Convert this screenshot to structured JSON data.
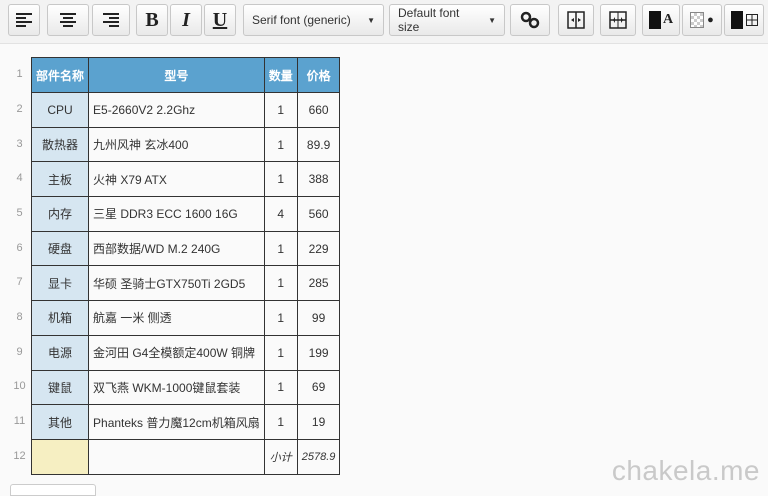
{
  "toolbar": {
    "bold_label": "B",
    "italic_label": "I",
    "underline_label": "U",
    "font_family": "Serif font (generic)",
    "font_size": "Default font size",
    "text_color_letter": "A"
  },
  "sheet": {
    "row_numbers": [
      "1",
      "2",
      "3",
      "4",
      "5",
      "6",
      "7",
      "8",
      "9",
      "10",
      "11",
      "12"
    ],
    "header": [
      "部件名称",
      "型号",
      "数量",
      "价格"
    ],
    "rows": [
      [
        "CPU",
        "E5-2660V2 2.2Ghz",
        "1",
        "660"
      ],
      [
        "散热器",
        "九州风神 玄冰400",
        "1",
        "89.9"
      ],
      [
        "主板",
        "火神 X79 ATX",
        "1",
        "388"
      ],
      [
        "内存",
        "三星 DDR3 ECC 1600 16G",
        "4",
        "560"
      ],
      [
        "硬盘",
        "西部数据/WD M.2 240G",
        "1",
        "229"
      ],
      [
        "显卡",
        "华硕 圣骑士GTX750Ti 2GD5",
        "1",
        "285"
      ],
      [
        "机箱",
        "航嘉 一米 侧透",
        "1",
        "99"
      ],
      [
        "电源",
        "金河田 G4全模额定400W 铜牌",
        "1",
        "199"
      ],
      [
        "键鼠",
        "双飞燕 WKM-1000键鼠套装",
        "1",
        "69"
      ],
      [
        "其他",
        "Phanteks 普力魔12cm机箱风扇",
        "1",
        "19"
      ]
    ],
    "subtotal_label": "小计",
    "subtotal_value": "2578.9"
  },
  "watermark": "chakela.me",
  "colors": {
    "header_bg": "#5ba2cf",
    "category_bg": "#d6e6f1",
    "blank_cell_bg": "#f6efc2"
  }
}
